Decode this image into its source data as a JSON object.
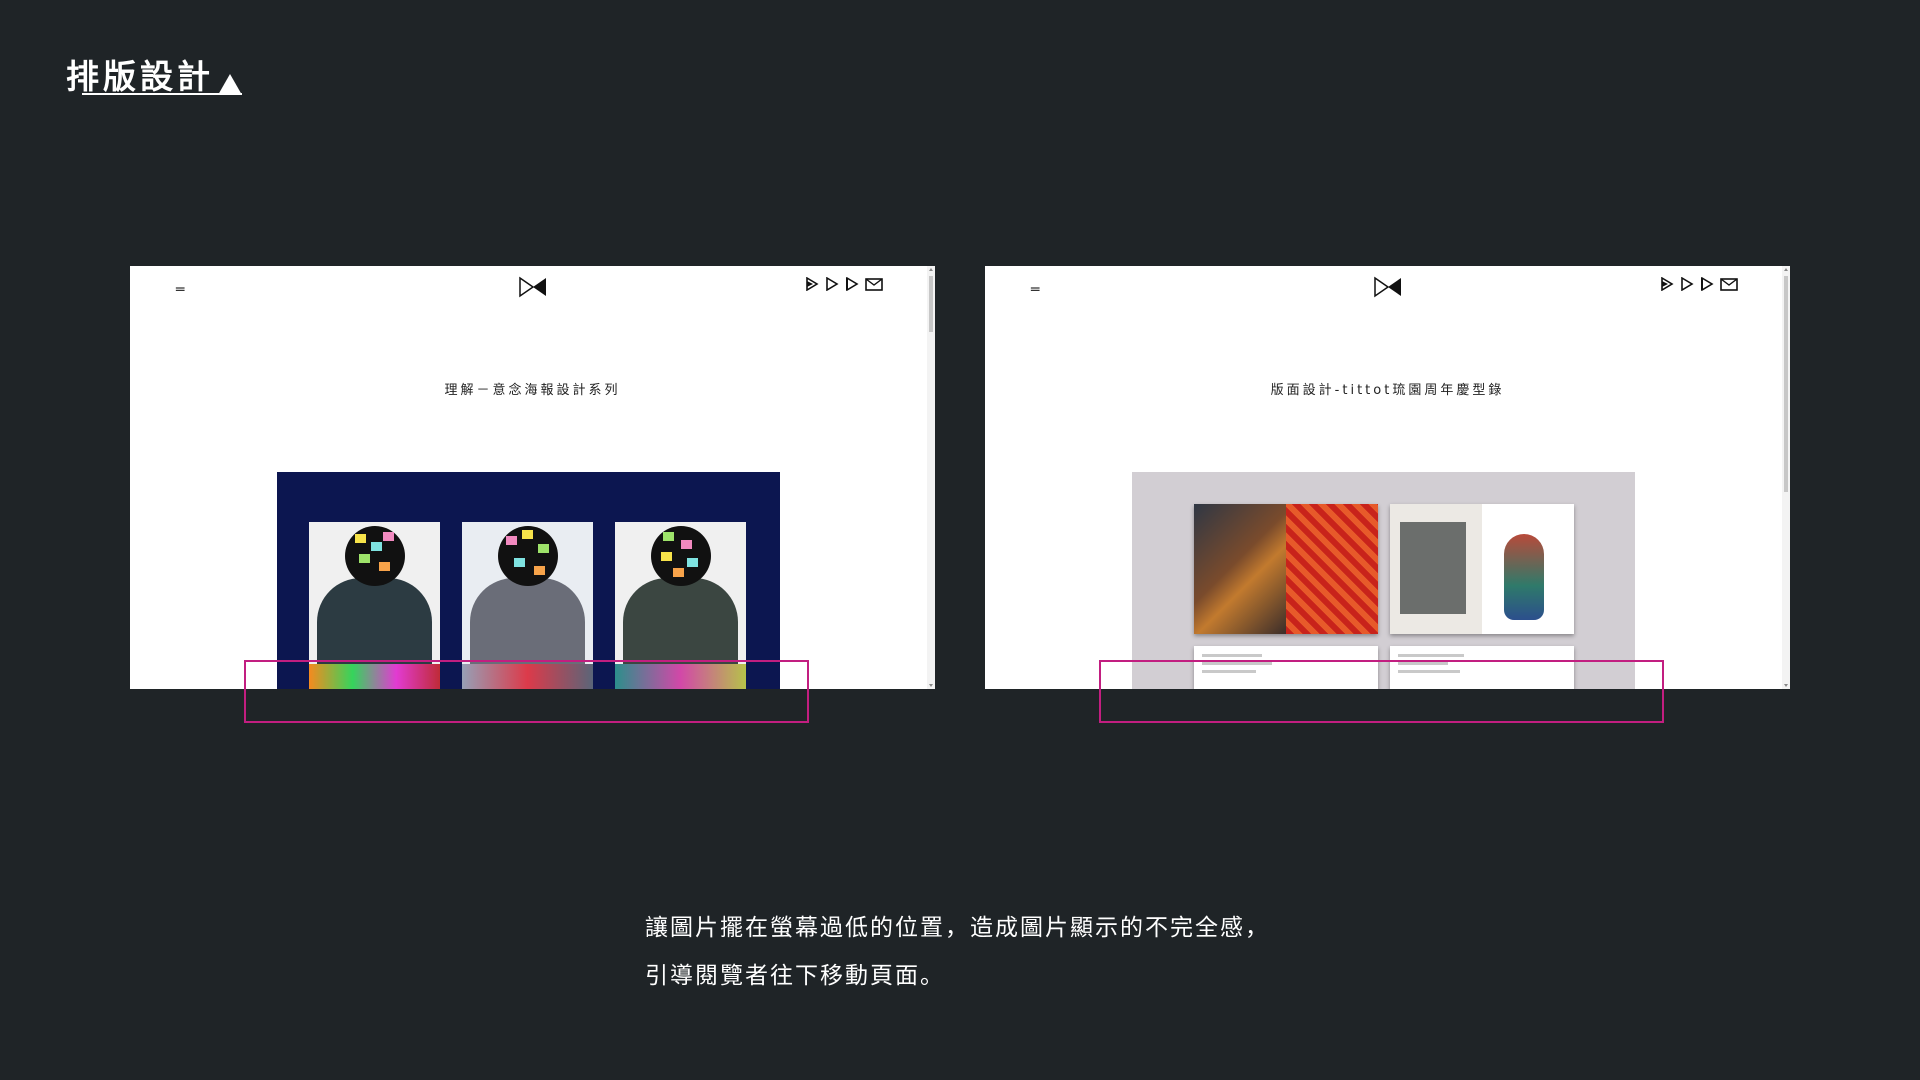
{
  "slide": {
    "title": "排版設計"
  },
  "windows": [
    {
      "menu_icon": "menu-icon",
      "heading": "理解－意念海報設計系列",
      "hero_type": "poster-series"
    },
    {
      "menu_icon": "menu-icon",
      "heading": "版面設計-tittot琉園周年慶型錄",
      "hero_type": "catalog-spreads"
    }
  ],
  "social_icons": [
    "play-icon",
    "play-icon",
    "play-icon",
    "mail-icon"
  ],
  "caption": {
    "line1": "讓圖片擺在螢幕過低的位置，造成圖片顯示的不完全感，",
    "line2": "引導閱覽者往下移動頁面。"
  },
  "colors": {
    "background": "#1f2427",
    "highlight_box": "#c21e80",
    "left_hero_bg": "#0c1650",
    "right_hero_bg": "#d2ced3"
  }
}
